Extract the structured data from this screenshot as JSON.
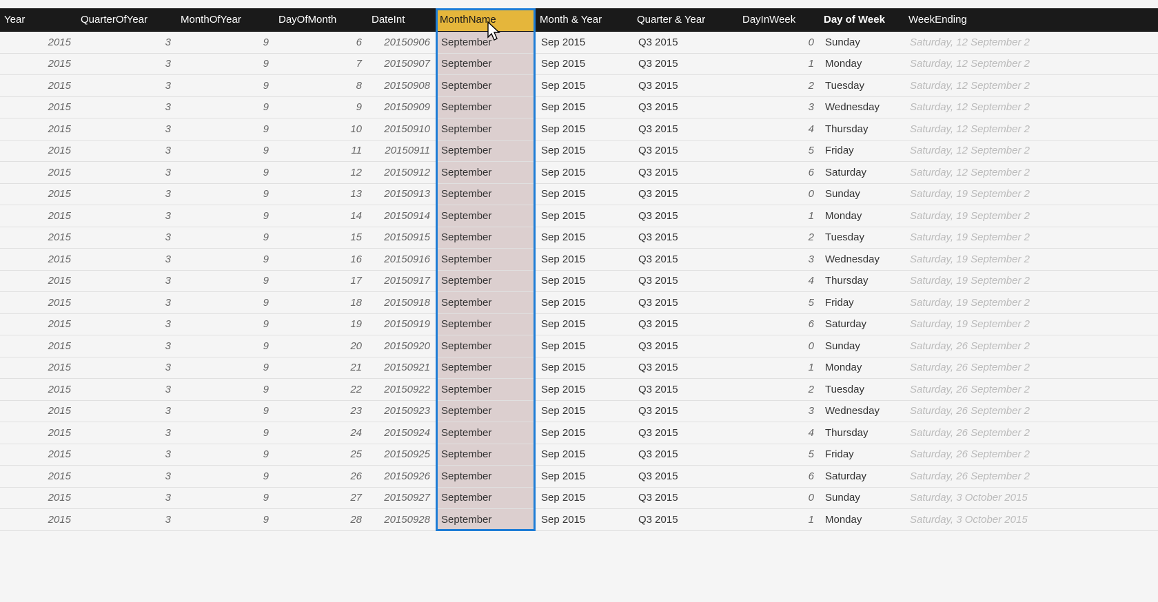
{
  "columns": [
    {
      "name": "Year",
      "align": "num"
    },
    {
      "name": "QuarterOfYear",
      "align": "num"
    },
    {
      "name": "MonthOfYear",
      "align": "num"
    },
    {
      "name": "DayOfMonth",
      "align": "num"
    },
    {
      "name": "DateInt",
      "align": "num"
    },
    {
      "name": "MonthName",
      "align": "txt",
      "selected": true
    },
    {
      "name": "Month & Year",
      "align": "txt"
    },
    {
      "name": "Quarter & Year",
      "align": "txt"
    },
    {
      "name": "DayInWeek",
      "align": "num"
    },
    {
      "name": "Day of Week",
      "align": "txt"
    },
    {
      "name": "WeekEnding",
      "align": "txt",
      "faded": true
    }
  ],
  "rows": [
    {
      "year": 2015,
      "q": 3,
      "m": 9,
      "d": 6,
      "di": 20150906,
      "mn": "September",
      "my": "Sep 2015",
      "qy": "Q3 2015",
      "diw": 0,
      "dow": "Sunday",
      "we": "Saturday, 12 September 2"
    },
    {
      "year": 2015,
      "q": 3,
      "m": 9,
      "d": 7,
      "di": 20150907,
      "mn": "September",
      "my": "Sep 2015",
      "qy": "Q3 2015",
      "diw": 1,
      "dow": "Monday",
      "we": "Saturday, 12 September 2"
    },
    {
      "year": 2015,
      "q": 3,
      "m": 9,
      "d": 8,
      "di": 20150908,
      "mn": "September",
      "my": "Sep 2015",
      "qy": "Q3 2015",
      "diw": 2,
      "dow": "Tuesday",
      "we": "Saturday, 12 September 2"
    },
    {
      "year": 2015,
      "q": 3,
      "m": 9,
      "d": 9,
      "di": 20150909,
      "mn": "September",
      "my": "Sep 2015",
      "qy": "Q3 2015",
      "diw": 3,
      "dow": "Wednesday",
      "we": "Saturday, 12 September 2"
    },
    {
      "year": 2015,
      "q": 3,
      "m": 9,
      "d": 10,
      "di": 20150910,
      "mn": "September",
      "my": "Sep 2015",
      "qy": "Q3 2015",
      "diw": 4,
      "dow": "Thursday",
      "we": "Saturday, 12 September 2"
    },
    {
      "year": 2015,
      "q": 3,
      "m": 9,
      "d": 11,
      "di": 20150911,
      "mn": "September",
      "my": "Sep 2015",
      "qy": "Q3 2015",
      "diw": 5,
      "dow": "Friday",
      "we": "Saturday, 12 September 2"
    },
    {
      "year": 2015,
      "q": 3,
      "m": 9,
      "d": 12,
      "di": 20150912,
      "mn": "September",
      "my": "Sep 2015",
      "qy": "Q3 2015",
      "diw": 6,
      "dow": "Saturday",
      "we": "Saturday, 12 September 2"
    },
    {
      "year": 2015,
      "q": 3,
      "m": 9,
      "d": 13,
      "di": 20150913,
      "mn": "September",
      "my": "Sep 2015",
      "qy": "Q3 2015",
      "diw": 0,
      "dow": "Sunday",
      "we": "Saturday, 19 September 2"
    },
    {
      "year": 2015,
      "q": 3,
      "m": 9,
      "d": 14,
      "di": 20150914,
      "mn": "September",
      "my": "Sep 2015",
      "qy": "Q3 2015",
      "diw": 1,
      "dow": "Monday",
      "we": "Saturday, 19 September 2"
    },
    {
      "year": 2015,
      "q": 3,
      "m": 9,
      "d": 15,
      "di": 20150915,
      "mn": "September",
      "my": "Sep 2015",
      "qy": "Q3 2015",
      "diw": 2,
      "dow": "Tuesday",
      "we": "Saturday, 19 September 2"
    },
    {
      "year": 2015,
      "q": 3,
      "m": 9,
      "d": 16,
      "di": 20150916,
      "mn": "September",
      "my": "Sep 2015",
      "qy": "Q3 2015",
      "diw": 3,
      "dow": "Wednesday",
      "we": "Saturday, 19 September 2"
    },
    {
      "year": 2015,
      "q": 3,
      "m": 9,
      "d": 17,
      "di": 20150917,
      "mn": "September",
      "my": "Sep 2015",
      "qy": "Q3 2015",
      "diw": 4,
      "dow": "Thursday",
      "we": "Saturday, 19 September 2"
    },
    {
      "year": 2015,
      "q": 3,
      "m": 9,
      "d": 18,
      "di": 20150918,
      "mn": "September",
      "my": "Sep 2015",
      "qy": "Q3 2015",
      "diw": 5,
      "dow": "Friday",
      "we": "Saturday, 19 September 2"
    },
    {
      "year": 2015,
      "q": 3,
      "m": 9,
      "d": 19,
      "di": 20150919,
      "mn": "September",
      "my": "Sep 2015",
      "qy": "Q3 2015",
      "diw": 6,
      "dow": "Saturday",
      "we": "Saturday, 19 September 2"
    },
    {
      "year": 2015,
      "q": 3,
      "m": 9,
      "d": 20,
      "di": 20150920,
      "mn": "September",
      "my": "Sep 2015",
      "qy": "Q3 2015",
      "diw": 0,
      "dow": "Sunday",
      "we": "Saturday, 26 September 2"
    },
    {
      "year": 2015,
      "q": 3,
      "m": 9,
      "d": 21,
      "di": 20150921,
      "mn": "September",
      "my": "Sep 2015",
      "qy": "Q3 2015",
      "diw": 1,
      "dow": "Monday",
      "we": "Saturday, 26 September 2"
    },
    {
      "year": 2015,
      "q": 3,
      "m": 9,
      "d": 22,
      "di": 20150922,
      "mn": "September",
      "my": "Sep 2015",
      "qy": "Q3 2015",
      "diw": 2,
      "dow": "Tuesday",
      "we": "Saturday, 26 September 2"
    },
    {
      "year": 2015,
      "q": 3,
      "m": 9,
      "d": 23,
      "di": 20150923,
      "mn": "September",
      "my": "Sep 2015",
      "qy": "Q3 2015",
      "diw": 3,
      "dow": "Wednesday",
      "we": "Saturday, 26 September 2"
    },
    {
      "year": 2015,
      "q": 3,
      "m": 9,
      "d": 24,
      "di": 20150924,
      "mn": "September",
      "my": "Sep 2015",
      "qy": "Q3 2015",
      "diw": 4,
      "dow": "Thursday",
      "we": "Saturday, 26 September 2"
    },
    {
      "year": 2015,
      "q": 3,
      "m": 9,
      "d": 25,
      "di": 20150925,
      "mn": "September",
      "my": "Sep 2015",
      "qy": "Q3 2015",
      "diw": 5,
      "dow": "Friday",
      "we": "Saturday, 26 September 2"
    },
    {
      "year": 2015,
      "q": 3,
      "m": 9,
      "d": 26,
      "di": 20150926,
      "mn": "September",
      "my": "Sep 2015",
      "qy": "Q3 2015",
      "diw": 6,
      "dow": "Saturday",
      "we": "Saturday, 26 September 2"
    },
    {
      "year": 2015,
      "q": 3,
      "m": 9,
      "d": 27,
      "di": 20150927,
      "mn": "September",
      "my": "Sep 2015",
      "qy": "Q3 2015",
      "diw": 0,
      "dow": "Sunday",
      "we": "Saturday, 3 October 2015"
    },
    {
      "year": 2015,
      "q": 3,
      "m": 9,
      "d": 28,
      "di": 20150928,
      "mn": "September",
      "my": "Sep 2015",
      "qy": "Q3 2015",
      "diw": 1,
      "dow": "Monday",
      "we": "Saturday, 3 October 2015"
    }
  ]
}
